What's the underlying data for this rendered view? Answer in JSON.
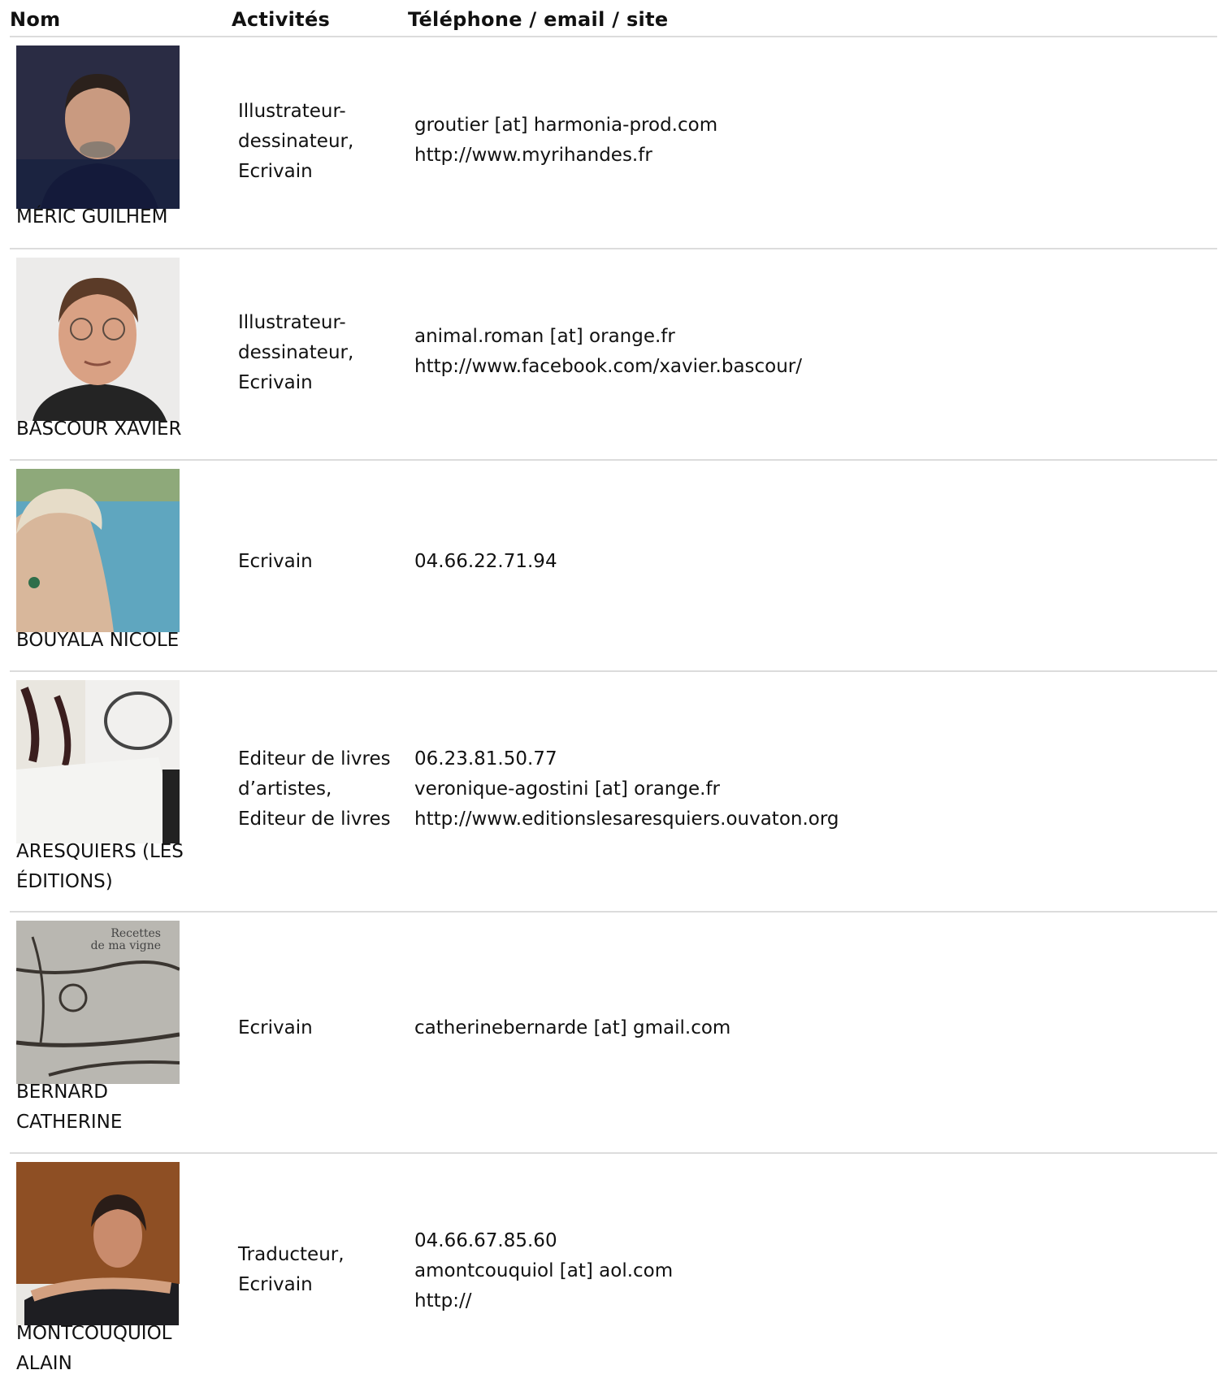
{
  "headers": {
    "name": "Nom",
    "activities": "Activités",
    "contact": "Téléphone / email / site"
  },
  "rows": [
    {
      "name": "MÉRIC GUILHEM",
      "activities": "Illustrateur-\ndessinateur,\nEcrivain",
      "contact": "groutier [at] harmonia-prod.com\nhttp://www.myrihandes.fr"
    },
    {
      "name": "BASCOUR XAVIER",
      "activities": "Illustrateur-\ndessinateur,\nEcrivain",
      "contact": "animal.roman [at] orange.fr\nhttp://www.facebook.com/xavier.bascour/"
    },
    {
      "name": "BOUYALA NICOLE",
      "activities": "Ecrivain",
      "contact": "04.66.22.71.94"
    },
    {
      "name": "ARESQUIERS (LES\nÉDITIONS)",
      "activities": "Editeur de livres\nd’artistes,\nEditeur de livres",
      "contact": "06.23.81.50.77\nveronique-agostini [at] orange.fr\nhttp://www.editionslesaresquiers.ouvaton.org"
    },
    {
      "name": "BERNARD\nCATHERINE",
      "activities": "Ecrivain",
      "contact": "catherinebernarde [at] gmail.com",
      "photo_text": "Recettes\nde ma vigne"
    },
    {
      "name": "MONTCOUQUIOL\nALAIN",
      "activities": "Traducteur,\nEcrivain",
      "contact": "04.66.67.85.60\namontcouquiol [at] aol.com\nhttp://"
    }
  ],
  "colors": {
    "divider": "#dcdcdc",
    "text": "#111111"
  }
}
